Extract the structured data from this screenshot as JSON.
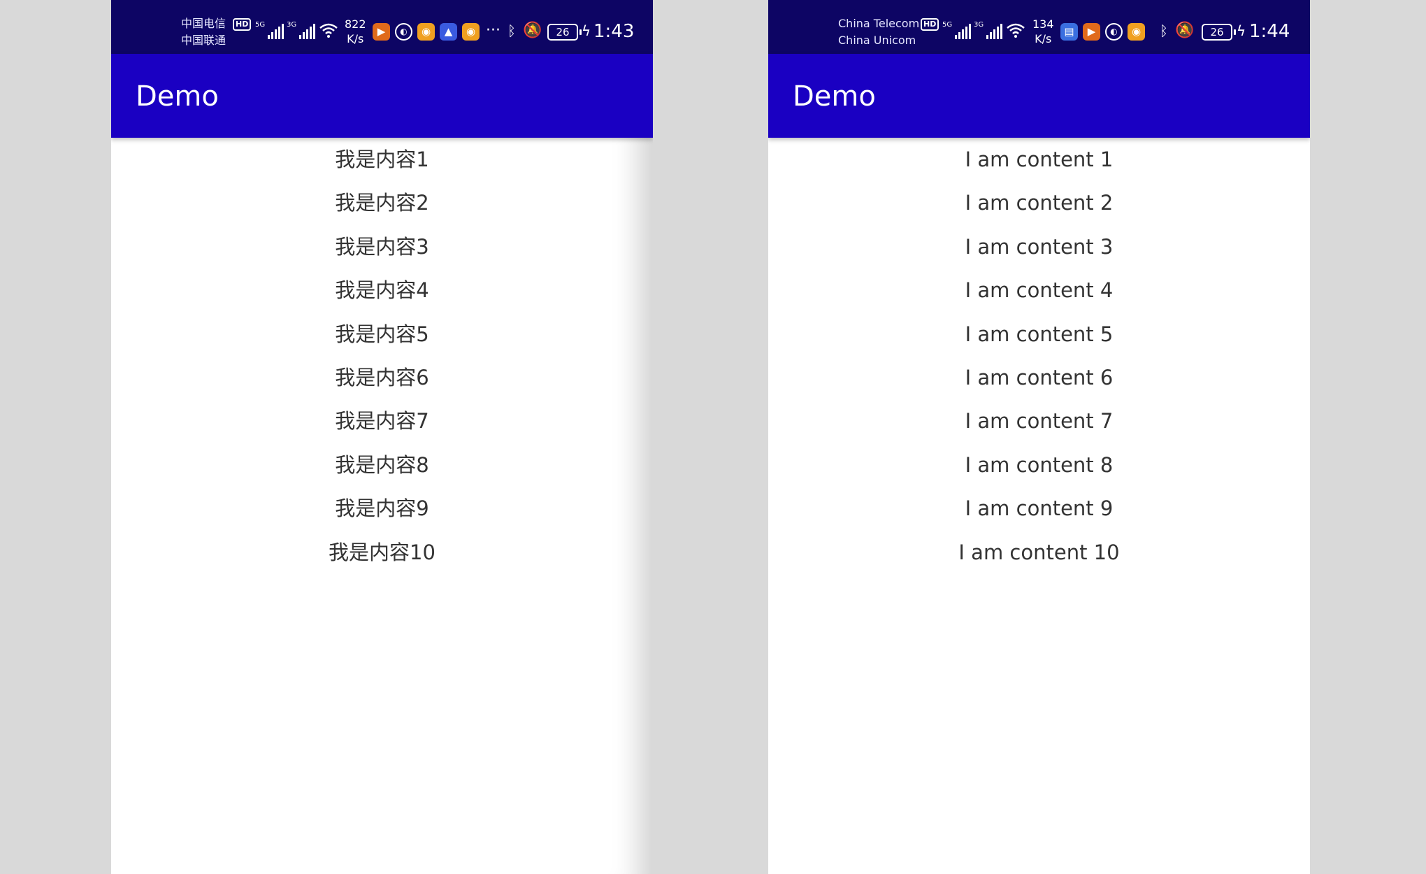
{
  "colors": {
    "statusbar_bg": "#0d0564",
    "appbar_bg": "#1a00c2",
    "page_bg": "#d9d9d9",
    "text": "#333333"
  },
  "left": {
    "status": {
      "carrier1": "中国电信",
      "carrier2": "中国联通",
      "hd": "HD",
      "signal1": "5G",
      "signal2": "3G",
      "speed_value": "822",
      "speed_unit": "K/s",
      "more": "···",
      "battery": "26",
      "time": "1:43"
    },
    "app_title": "Demo",
    "items": [
      "我是内容1",
      "我是内容2",
      "我是内容3",
      "我是内容4",
      "我是内容5",
      "我是内容6",
      "我是内容7",
      "我是内容8",
      "我是内容9",
      "我是内容10"
    ]
  },
  "right": {
    "status": {
      "carrier1": "China Telecom",
      "carrier2": "China Unicom",
      "hd": "HD",
      "signal1": "5G",
      "signal2": "3G",
      "speed_value": "134",
      "speed_unit": "K/s",
      "battery": "26",
      "time": "1:44"
    },
    "app_title": "Demo",
    "items": [
      "I am content 1",
      "I am content 2",
      "I am content 3",
      "I am content 4",
      "I am content 5",
      "I am content 6",
      "I am content 7",
      "I am content 8",
      "I am content 9",
      "I am content 10"
    ]
  }
}
